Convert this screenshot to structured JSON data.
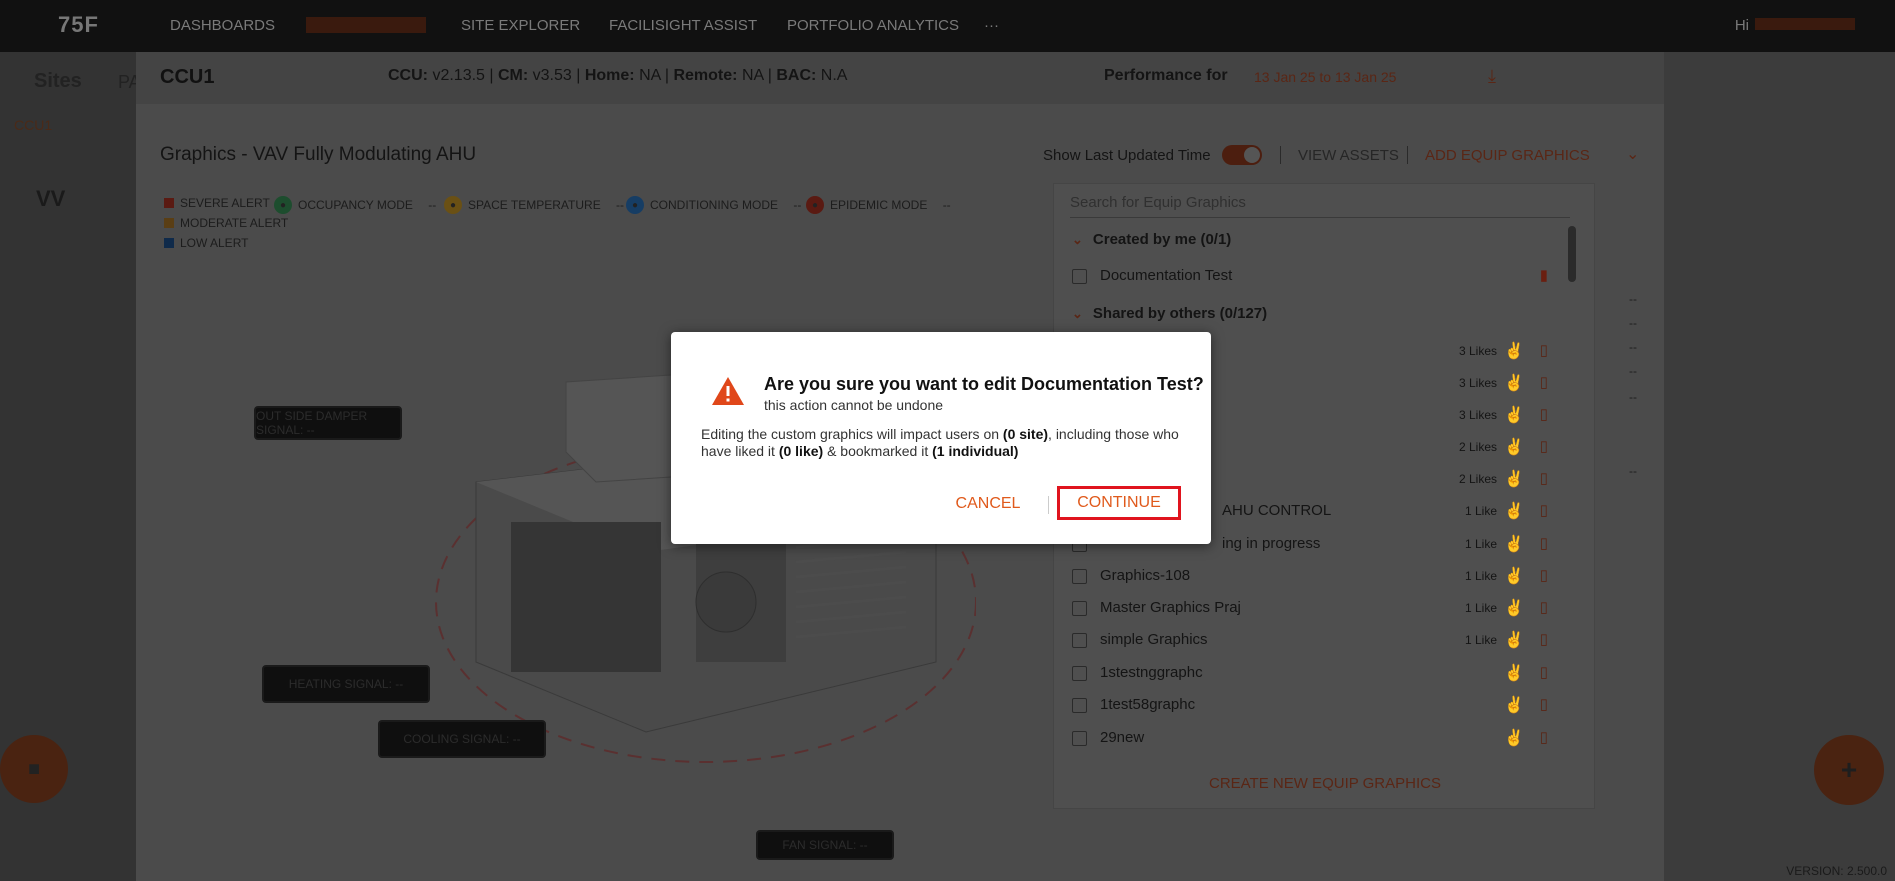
{
  "nav": {
    "logo": "75F",
    "items": [
      "DASHBOARDS",
      "",
      "SITE EXPLORER",
      "FACILISIGHT ASSIST",
      "PORTFOLIO ANALYTICS",
      "···"
    ],
    "user": "Hi"
  },
  "page": {
    "sites_label": "Sites",
    "tab_partial": "PA",
    "crumb": "CCU1",
    "vv_label": "VV",
    "version": "VERSION: 2.500.0"
  },
  "panel": {
    "ccu_title": "CCU1",
    "meta": {
      "ccu_label": "CCU:",
      "ccu_value": "v2.13.5",
      "cm_label": "CM:",
      "cm_value": "v3.53",
      "home_label": "Home:",
      "home_value": "NA",
      "remote_label": "Remote:",
      "remote_value": "NA",
      "bac_label": "BAC:",
      "bac_value": "N.A"
    },
    "performance_label": "Performance for",
    "performance_range": "13 Jan 25 to 13 Jan 25",
    "graphics_title": "Graphics - VAV Fully Modulating AHU",
    "show_last_updated": "Show Last Updated Time",
    "view_assets": "VIEW ASSETS",
    "add_equip_graphics": "ADD EQUIP GRAPHICS",
    "legend": {
      "severe": "SEVERE ALERT",
      "moderate": "MODERATE ALERT",
      "low": "LOW ALERT",
      "colors": {
        "severe": "#5a1a12",
        "moderate": "#5a3e14",
        "low": "#0f2a4a"
      }
    },
    "modes": [
      {
        "label": "OCCUPANCY MODE",
        "value": "--",
        "icon": "occupancy-icon",
        "color": "#1d4d2e"
      },
      {
        "label": "SPACE TEMPERATURE",
        "value": "--",
        "icon": "temperature-icon",
        "color": "#6a5014"
      },
      {
        "label": "CONDITIONING MODE",
        "value": "--",
        "icon": "conditioning-icon",
        "color": "#163d64"
      },
      {
        "label": "EPIDEMIC MODE",
        "value": "--",
        "icon": "shield-icon",
        "color": "#5a1a12"
      }
    ],
    "signals": {
      "outside_damper": "OUT SIDE DAMPER SIGNAL: --",
      "heating": "HEATING SIGNAL: --",
      "cooling": "COOLING SIGNAL: --",
      "fan": "FAN SIGNAL: --"
    },
    "dash_values": [
      "--",
      "--",
      "--",
      "--",
      "--",
      "--"
    ]
  },
  "list": {
    "search_placeholder": "Search for Equip Graphics",
    "created_group": "Created by me (0/1)",
    "shared_group": "Shared by others (0/127)",
    "created_items": [
      {
        "name": "Documentation Test",
        "likes": "",
        "bookmarked": true
      }
    ],
    "shared_items": [
      {
        "name": "",
        "likes": "3 Likes"
      },
      {
        "name": "",
        "likes": "3 Likes"
      },
      {
        "name": "",
        "likes": "3 Likes"
      },
      {
        "name": "",
        "likes": "2 Likes"
      },
      {
        "name": "",
        "likes": "2 Likes"
      },
      {
        "name": "AHU CONTROL",
        "likes": "1 Like"
      },
      {
        "name": "ing in progress",
        "likes": "1 Like"
      },
      {
        "name": "Graphics-108",
        "likes": "1 Like"
      },
      {
        "name": "Master Graphics Praj",
        "likes": "1 Like"
      },
      {
        "name": "simple Graphics",
        "likes": "1 Like"
      },
      {
        "name": "1stestnggraphc",
        "likes": ""
      },
      {
        "name": "1test58graphc",
        "likes": ""
      },
      {
        "name": "29new",
        "likes": ""
      }
    ],
    "create_new": "CREATE NEW EQUIP GRAPHICS"
  },
  "dialog": {
    "title": "Are you sure you want to edit Documentation Test?",
    "subtitle": "this action cannot be undone",
    "body_pre": "Editing the custom graphics will impact users on ",
    "body_sites": "(0 site)",
    "body_mid": ", including those who have liked it ",
    "body_likes": "(0 like)",
    "body_mid2": " & bookmarked it ",
    "body_bookmarks": "(1 individual)",
    "cancel_label": "CANCEL",
    "continue_label": "CONTINUE",
    "accent": "#e05a1c",
    "highlight": "#e0141e"
  }
}
